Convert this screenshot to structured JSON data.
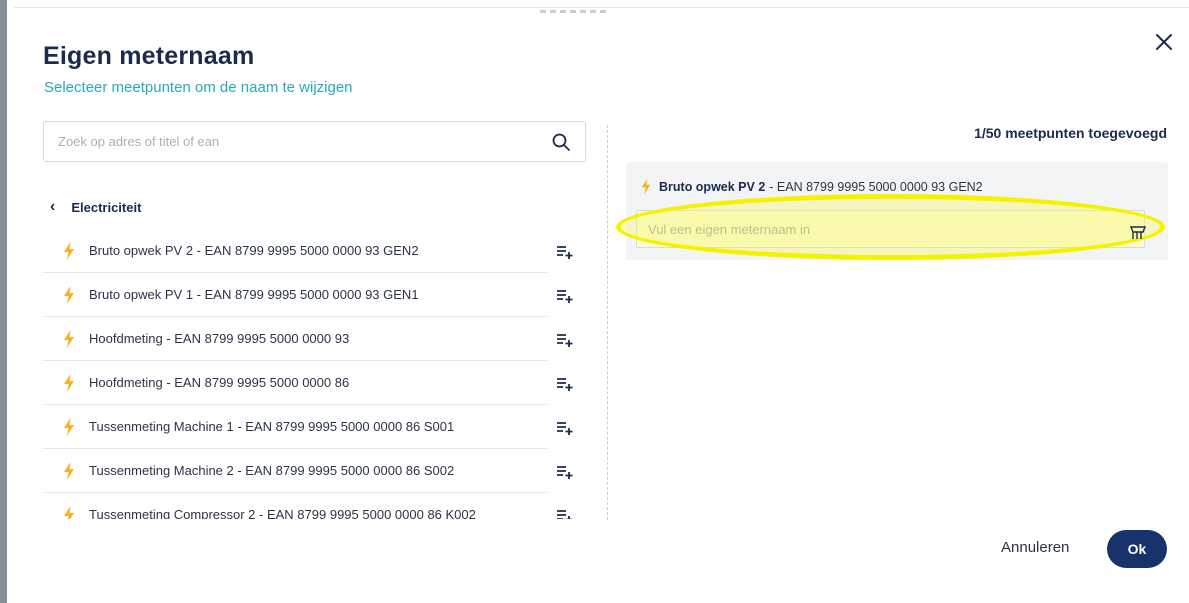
{
  "modal": {
    "title": "Eigen meternaam",
    "subtitle": "Selecteer meetpunten om de naam te wijzigen"
  },
  "search": {
    "placeholder": "Zoek op adres of titel of ean",
    "icon": "search-icon"
  },
  "breadcrumb": {
    "label": "Electriciteit",
    "icon": "chevron-left-icon"
  },
  "meters": [
    {
      "label": "Bruto opwek PV 2 - EAN 8799 9995 5000 0000 93 GEN2"
    },
    {
      "label": "Bruto opwek PV 1 - EAN 8799 9995 5000 0000 93 GEN1"
    },
    {
      "label": "Hoofdmeting - EAN 8799 9995 5000 0000 93"
    },
    {
      "label": "Hoofdmeting - EAN 8799 9995 5000 0000 86"
    },
    {
      "label": "Tussenmeting Machine 1 - EAN 8799 9995 5000 0000 86 S001"
    },
    {
      "label": "Tussenmeting Machine 2 - EAN 8799 9995 5000 0000 86 S002"
    },
    {
      "label": "Tussenmeting Compressor 2 - EAN 8799 9995 5000 0000 86 K002"
    }
  ],
  "selection": {
    "count_label": "1/50 meetpunten toegevoegd",
    "items": [
      {
        "name": "Bruto opwek PV 2",
        "ean": "- EAN 8799 9995 5000 0000 93 GEN2",
        "input_placeholder": "Vul een eigen meternaam in",
        "input_value": ""
      }
    ]
  },
  "footer": {
    "cancel_label": "Annuleren",
    "ok_label": "Ok"
  },
  "colors": {
    "primary": "#16336b",
    "accent_teal": "#2aa9b8",
    "bolt": "#f5b324",
    "highlight": "#f5f200"
  }
}
